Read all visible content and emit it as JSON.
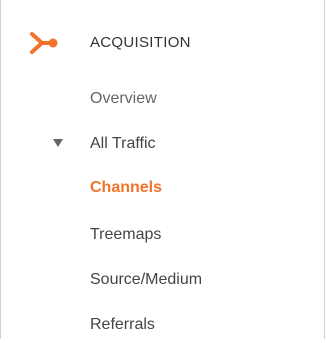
{
  "sidebar": {
    "section": {
      "title": "ACQUISITION",
      "icon": "acquisition-fork-icon",
      "accent_color": "#f2742b"
    },
    "overview_label": "Overview",
    "all_traffic": {
      "label": "All Traffic",
      "expanded": true,
      "icon": "caret-down-icon",
      "children": [
        {
          "label": "Channels",
          "active": true
        },
        {
          "label": "Treemaps",
          "active": false
        },
        {
          "label": "Source/Medium",
          "active": false
        },
        {
          "label": "Referrals",
          "active": false
        }
      ]
    }
  }
}
